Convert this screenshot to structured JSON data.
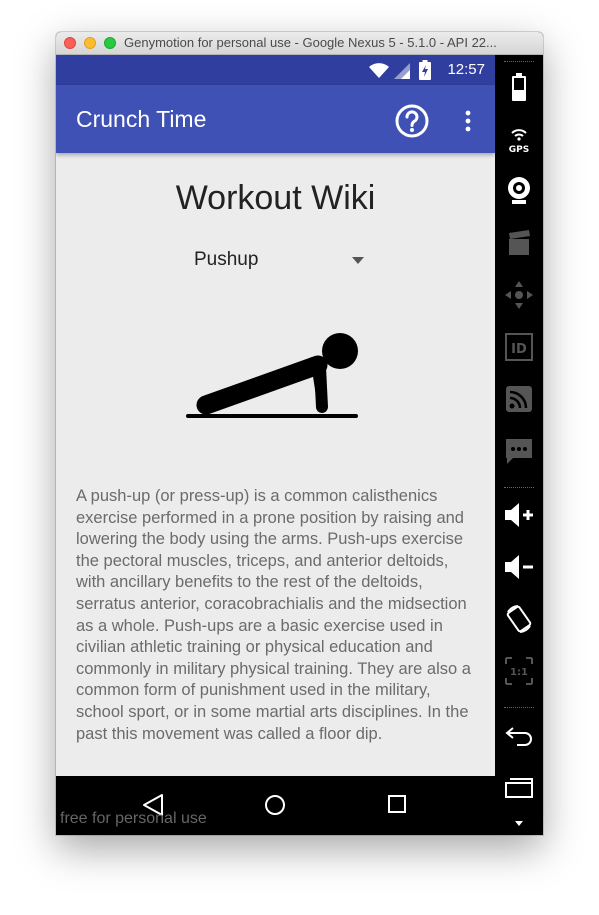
{
  "window": {
    "title": "Genymotion for personal use - Google Nexus 5 - 5.1.0 - API 22..."
  },
  "status_bar": {
    "time": "12:57"
  },
  "app_bar": {
    "title": "Crunch Time",
    "help_icon": "help-circle-icon",
    "menu_icon": "more-vert-icon"
  },
  "content": {
    "heading": "Workout Wiki",
    "selected_exercise": "Pushup",
    "image": "pushup-pictogram",
    "description": "A push-up (or press-up) is a common calisthenics exercise performed in a prone position by raising and lowering the body using the arms. Push-ups exercise the pectoral muscles, triceps, and anterior deltoids, with ancillary benefits to the rest of the deltoids, serratus anterior, coracobrachialis and the midsection as a whole. Push-ups are a basic exercise used in civilian athletic training or physical education and commonly in military physical training. They are also a common form of punishment used in the military, school sport, or in some martial arts disciplines. In the past this movement was called a floor dip."
  },
  "nav_bar": {
    "watermark": "free for personal use"
  },
  "sidebar": {
    "gps_label": "GPS",
    "id_label": "ID",
    "scale_label": "1:1",
    "items": [
      "battery-icon",
      "gps-icon",
      "webcam-icon",
      "media-icon",
      "dpad-icon",
      "device-id-icon",
      "cast-icon",
      "sms-icon",
      "volume-up-icon",
      "volume-down-icon",
      "rotate-icon",
      "scale-icon",
      "back-icon",
      "recent-apps-icon",
      "menu-down-icon"
    ]
  },
  "colors": {
    "primary": "#3f51b5",
    "primary_dark": "#303f9f",
    "background": "#ececec"
  }
}
